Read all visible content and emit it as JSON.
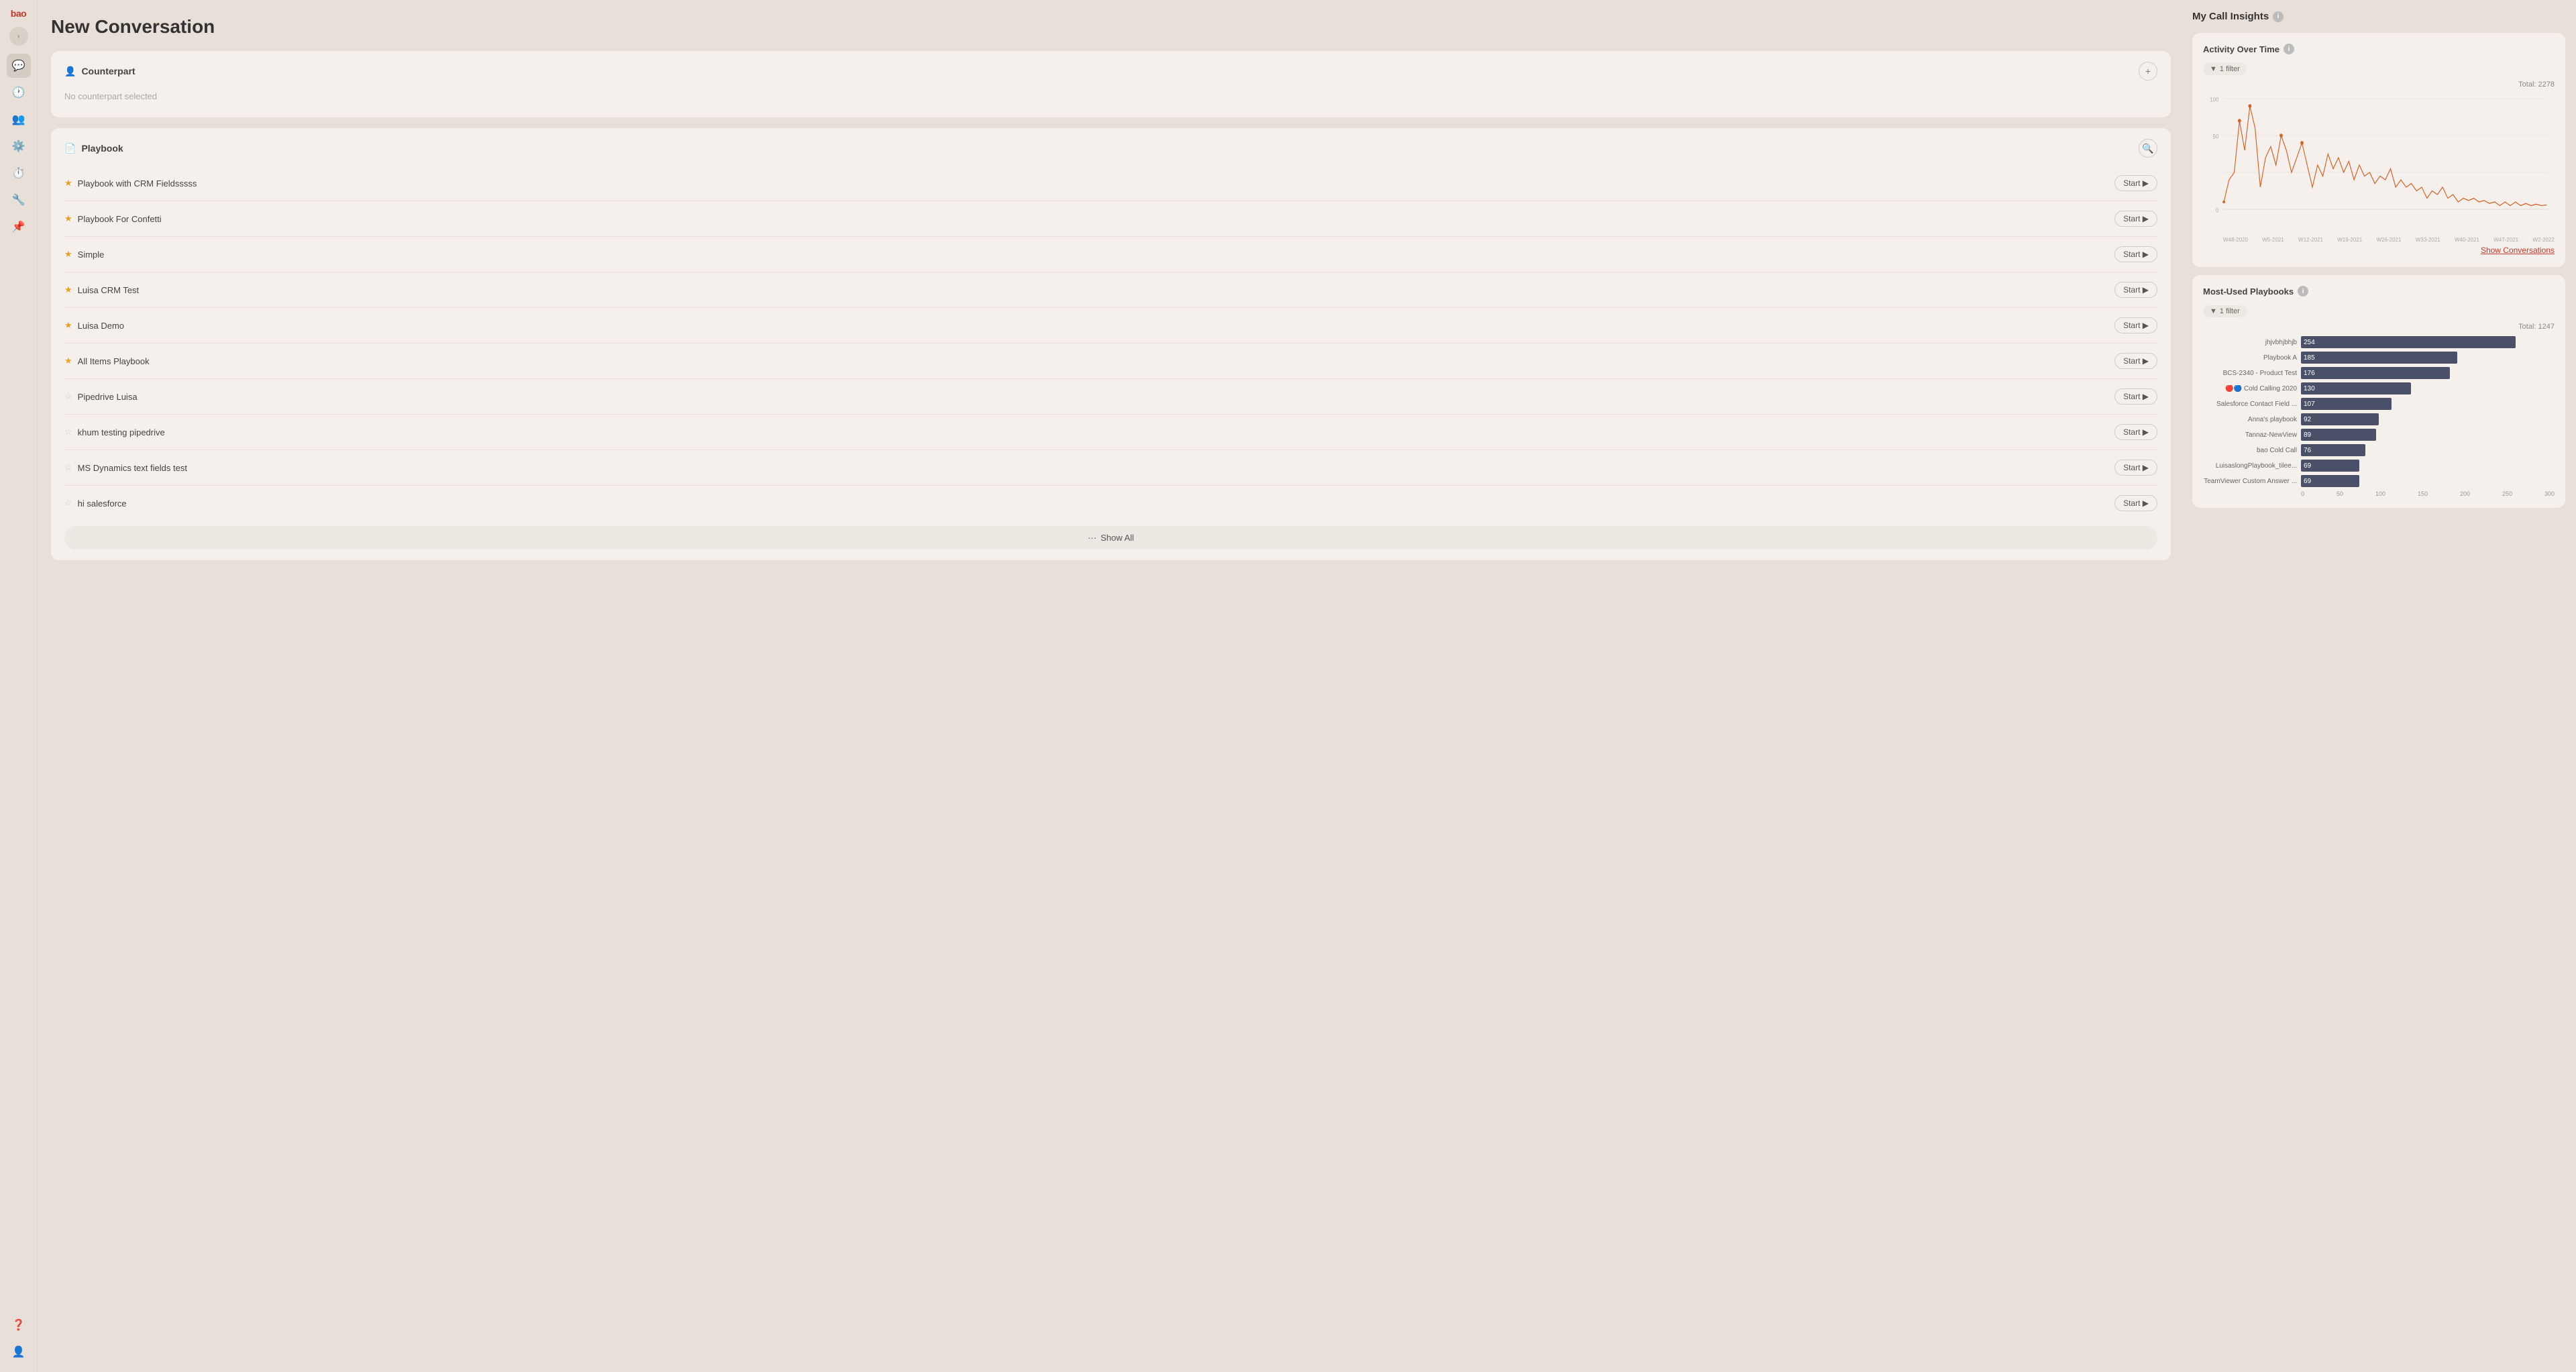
{
  "sidebar": {
    "logo": "bao",
    "items": [
      {
        "id": "chat",
        "icon": "💬",
        "active": true
      },
      {
        "id": "clock",
        "icon": "🕐",
        "active": false
      },
      {
        "id": "users",
        "icon": "👥",
        "active": false
      },
      {
        "id": "settings",
        "icon": "⚙️",
        "active": false
      },
      {
        "id": "clock2",
        "icon": "⏱️",
        "active": false
      },
      {
        "id": "tool",
        "icon": "🔧",
        "active": false
      },
      {
        "id": "pin",
        "icon": "📌",
        "active": false
      }
    ],
    "bottom_items": [
      {
        "id": "help",
        "icon": "❓"
      },
      {
        "id": "user",
        "icon": "👤"
      }
    ]
  },
  "page": {
    "title": "New Conversation"
  },
  "counterpart_section": {
    "header": "Counterpart",
    "placeholder": "No counterpart selected"
  },
  "playbook_section": {
    "header": "Playbook",
    "items": [
      {
        "name": "Playbook with CRM Fieldsssss",
        "starred": true
      },
      {
        "name": "Playbook For Confetti",
        "starred": true
      },
      {
        "name": "Simple",
        "starred": true
      },
      {
        "name": "Luisa CRM Test",
        "starred": true
      },
      {
        "name": "Luisa Demo",
        "starred": true
      },
      {
        "name": "All Items Playbook",
        "starred": true
      },
      {
        "name": "Pipedrive Luisa",
        "starred": false
      },
      {
        "name": "khum testing pipedrive",
        "starred": false
      },
      {
        "name": "MS Dynamics text fields test",
        "starred": false
      },
      {
        "name": "hi salesforce",
        "starred": false
      }
    ],
    "start_label": "Start",
    "show_all_label": "Show All"
  },
  "insights": {
    "title": "My Call Insights",
    "activity_chart": {
      "title": "Activity Over Time",
      "filter_label": "1 filter",
      "total_label": "Total: 2278",
      "y_axis": [
        "100",
        "50",
        "0"
      ],
      "show_conversations_label": "Show Conversations"
    },
    "playbooks_chart": {
      "title": "Most-Used Playbooks",
      "filter_label": "1 filter",
      "total_label": "Total: 1247",
      "bars": [
        {
          "label": "jhjvbhjbhjb",
          "value": 254,
          "max": 300
        },
        {
          "label": "Playbook A",
          "value": 185,
          "max": 300
        },
        {
          "label": "BCS-2340 - Product Test",
          "value": 176,
          "max": 300
        },
        {
          "label": "🔴🔵 Cold Calling 2020",
          "value": 130,
          "max": 300
        },
        {
          "label": "Salesforce Contact Field ...",
          "value": 107,
          "max": 300
        },
        {
          "label": "Anna's playbook",
          "value": 92,
          "max": 300
        },
        {
          "label": "Tannaz-NewView",
          "value": 89,
          "max": 300
        },
        {
          "label": "bao Cold Call",
          "value": 76,
          "max": 300
        },
        {
          "label": "LuisaslongPlaybook_tilee...",
          "value": 69,
          "max": 300
        },
        {
          "label": "TeamViewer Custom Answer ...",
          "value": 69,
          "max": 300
        }
      ],
      "axis_labels": [
        "0",
        "50",
        "100",
        "150",
        "200",
        "250",
        "300"
      ]
    }
  }
}
